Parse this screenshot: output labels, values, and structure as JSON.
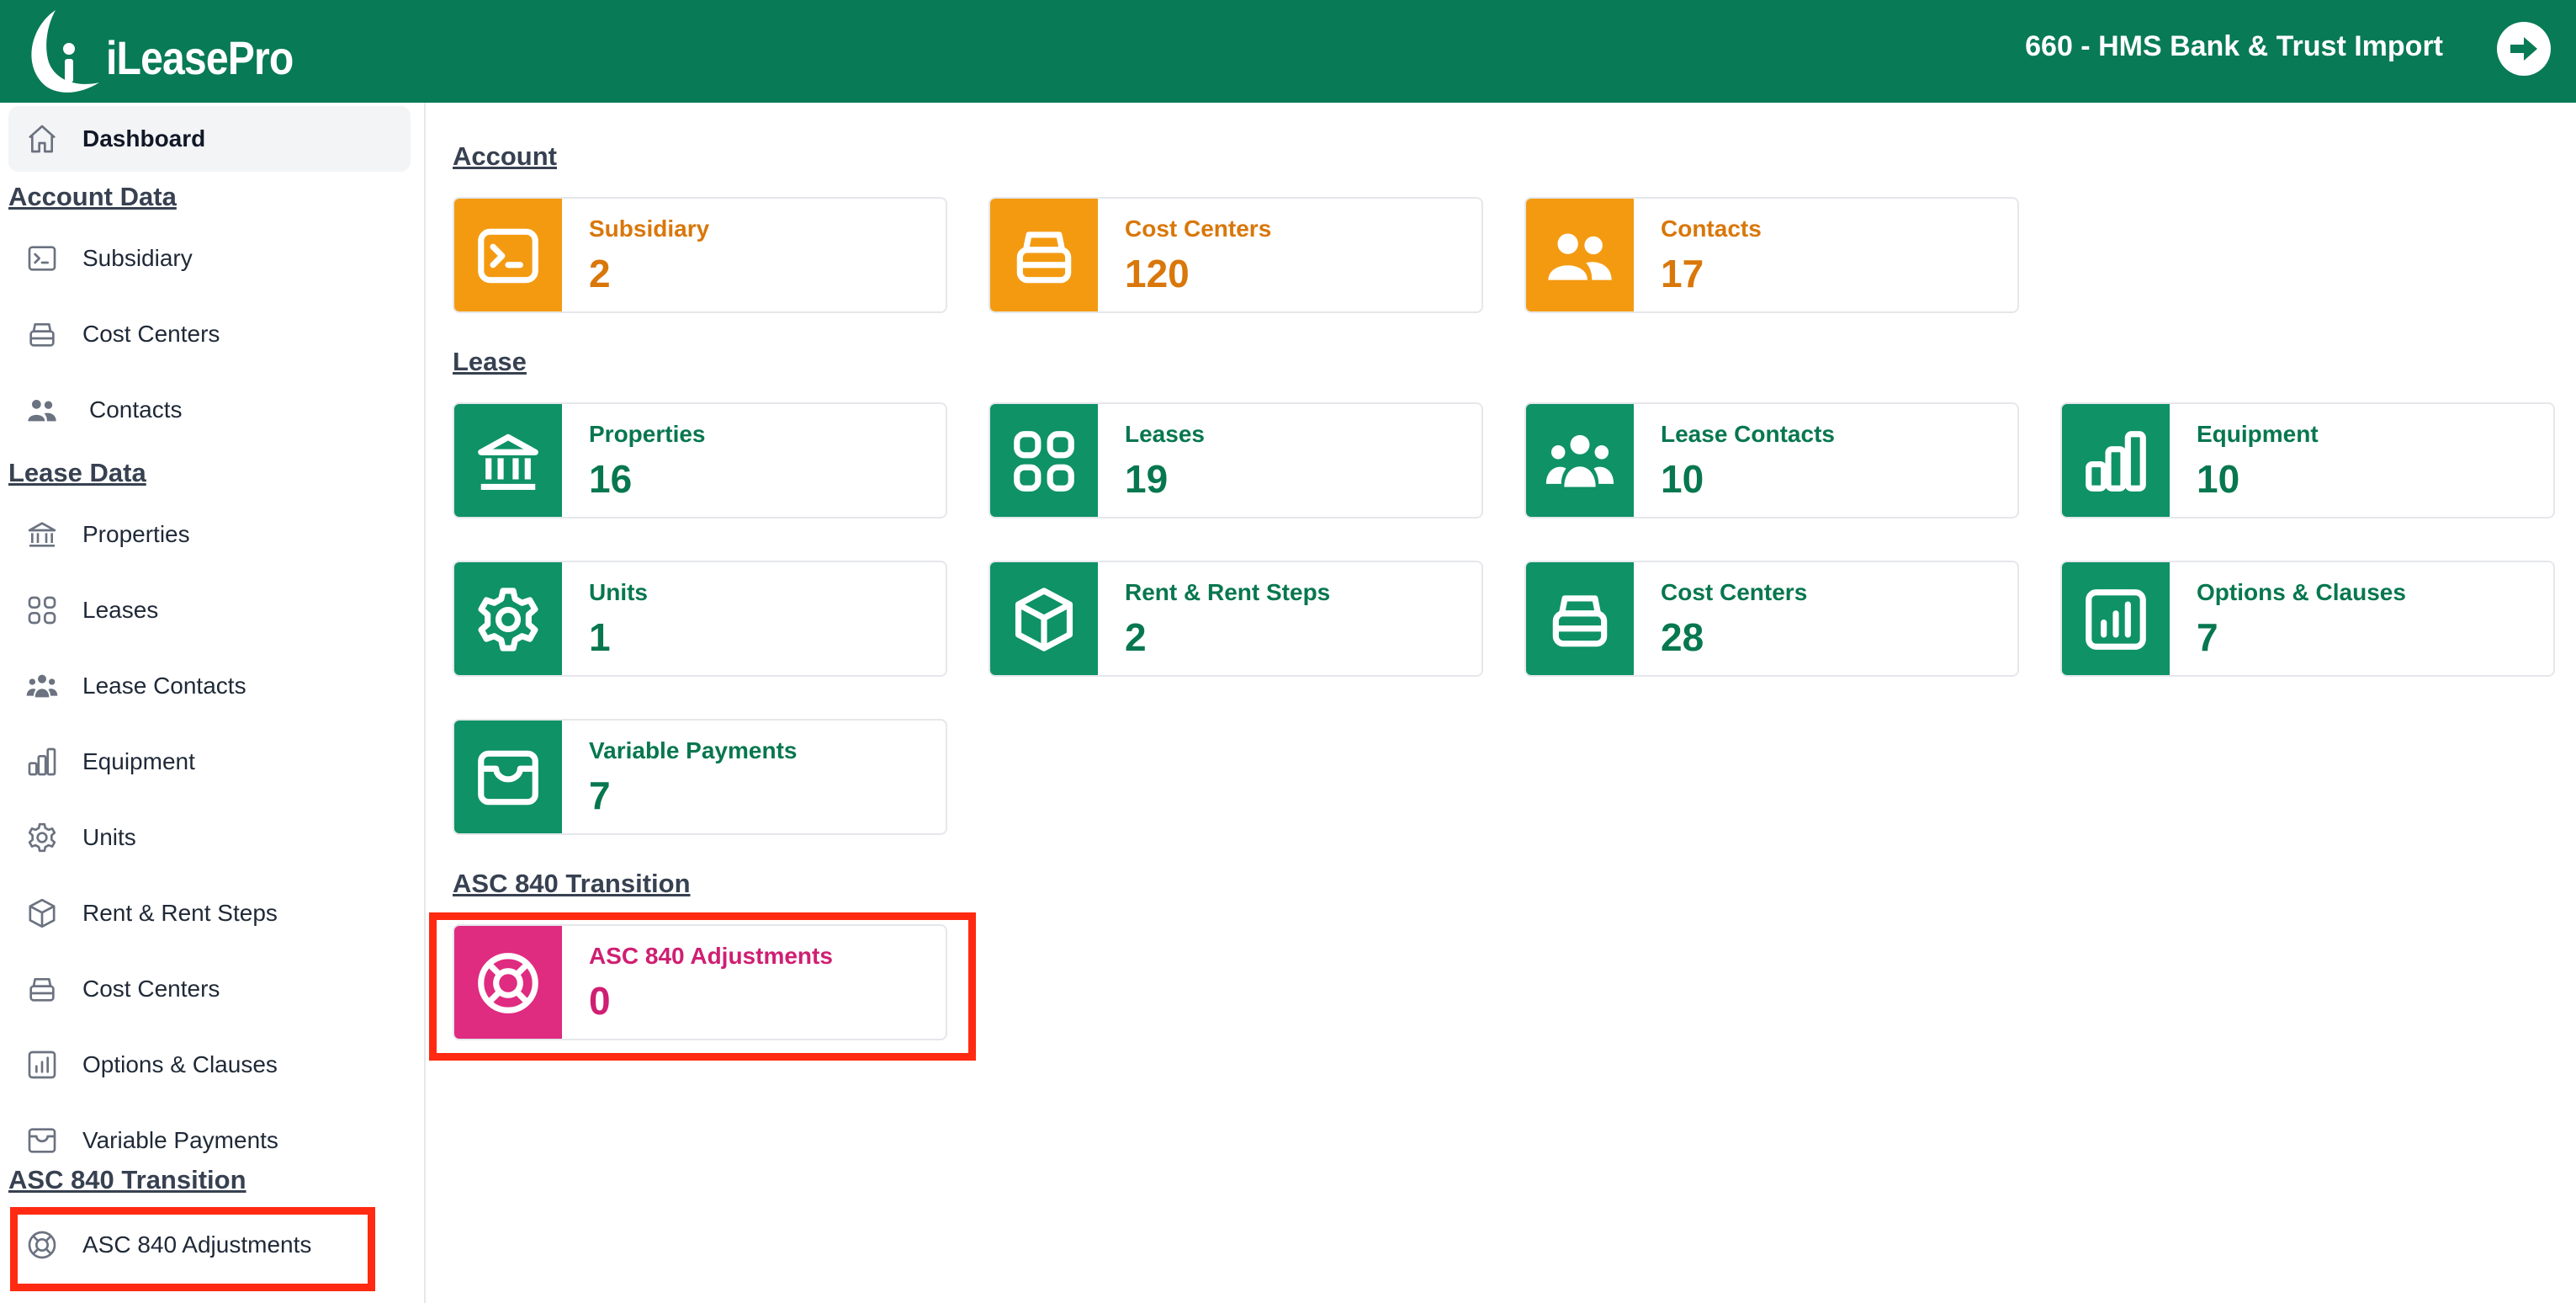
{
  "header": {
    "brand": "iLeasePro",
    "org_name": "660 - HMS Bank & Trust Import",
    "logout_icon": "arrow-right-circle-icon",
    "color": "#087a55"
  },
  "sidebar": {
    "dashboard": "Dashboard",
    "account_data": {
      "heading": "Account Data",
      "items": [
        "Subsidiary",
        "Cost Centers",
        "Contacts"
      ]
    },
    "lease_data": {
      "heading": "Lease Data",
      "items": [
        "Properties",
        "Leases",
        "Lease Contacts",
        "Equipment",
        "Units",
        "Rent & Rent Steps",
        "Cost Centers",
        "Options & Clauses",
        "Variable Payments"
      ]
    },
    "asc_transition": {
      "heading": "ASC 840 Transition",
      "items": [
        "ASC 840 Adjustments"
      ]
    }
  },
  "main": {
    "account": {
      "heading": "Account",
      "cards": [
        {
          "title": "Subsidiary",
          "value": "2",
          "icon": "terminal-icon"
        },
        {
          "title": "Cost Centers",
          "value": "120",
          "icon": "stack-icon"
        },
        {
          "title": "Contacts",
          "value": "17",
          "icon": "users-icon"
        }
      ]
    },
    "lease": {
      "heading": "Lease",
      "cards": [
        {
          "title": "Properties",
          "value": "16",
          "icon": "bank-icon"
        },
        {
          "title": "Leases",
          "value": "19",
          "icon": "grid-icon"
        },
        {
          "title": "Lease Contacts",
          "value": "10",
          "icon": "user-group-icon"
        },
        {
          "title": "Equipment",
          "value": "10",
          "icon": "bar-chart-icon"
        },
        {
          "title": "Units",
          "value": "1",
          "icon": "gear-icon"
        },
        {
          "title": "Rent & Rent Steps",
          "value": "2",
          "icon": "cube-icon"
        },
        {
          "title": "Cost Centers",
          "value": "28",
          "icon": "stack-icon"
        },
        {
          "title": "Options & Clauses",
          "value": "7",
          "icon": "chart-square-icon"
        },
        {
          "title": "Variable Payments",
          "value": "7",
          "icon": "inbox-icon"
        }
      ]
    },
    "asc": {
      "heading": "ASC 840 Transition",
      "cards": [
        {
          "title": "ASC 840 Adjustments",
          "value": "0",
          "icon": "lifebuoy-icon"
        }
      ]
    }
  },
  "colors": {
    "orange": "#f49a11",
    "green": "#0e9266",
    "pink": "#df2b80",
    "highlight": "#ff2a11"
  }
}
